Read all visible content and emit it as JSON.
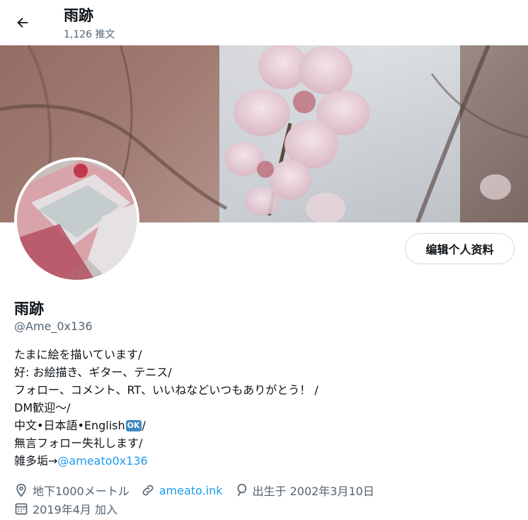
{
  "header": {
    "title": "雨跡",
    "tweet_count": "1,126 推文"
  },
  "profile": {
    "name": "雨跡",
    "handle": "@Ame_0x136",
    "edit_label": "编辑个人资料",
    "bio": {
      "line1": "たまに絵を描いています/",
      "line2": "好: お絵描き、ギター、テニス/",
      "line3": "フォロー、コメント、RT、いいねなどいつもありがとう！ /",
      "line4": "DM歓迎～/",
      "line5_prefix": "中文•日本語•English",
      "line5_badge": "OK",
      "line5_suffix": "/",
      "line6": "無言フォロー失礼します/",
      "line7_prefix": "雑多垢→",
      "line7_mention": "@ameato0x136"
    },
    "location": "地下1000メートル",
    "website": "ameato.ink",
    "birthday": "出生于 2002年3月10日",
    "joined": "2019年4月 加入"
  },
  "colors": {
    "accent": "#1d9bf0",
    "secondary_text": "#536471",
    "badge": "#3b88c3"
  }
}
